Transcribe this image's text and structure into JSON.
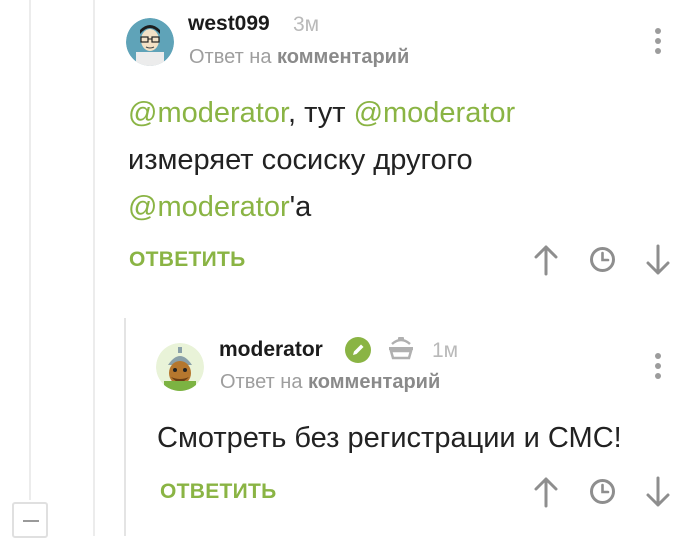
{
  "comments": [
    {
      "username": "west099",
      "time": "3м",
      "reply_prefix": "Ответ на",
      "reply_target": "комментарий",
      "body": {
        "mention1": "@moderator",
        "text1": ", тут ",
        "mention2": "@moderator",
        "text2": "измеряет сосиску другого",
        "mention3": "@moderator",
        "text3": "'a"
      },
      "reply_label": "ОТВЕТИТЬ"
    },
    {
      "username": "moderator",
      "time": "1м",
      "reply_prefix": "Ответ на",
      "reply_target": "комментарий",
      "body_text": "Смотреть без регистрации и СМС!",
      "reply_label": "ОТВЕТИТЬ"
    }
  ],
  "colors": {
    "accent": "#8ab444",
    "verified_badge": "#8ab444",
    "muted": "#9e9e9e"
  },
  "icons": [
    "user-avatar",
    "more-vertical-icon",
    "arrow-up-icon",
    "clock-icon",
    "arrow-down-icon",
    "verified-pencil-icon",
    "crown-icon",
    "collapse-minus-icon"
  ]
}
